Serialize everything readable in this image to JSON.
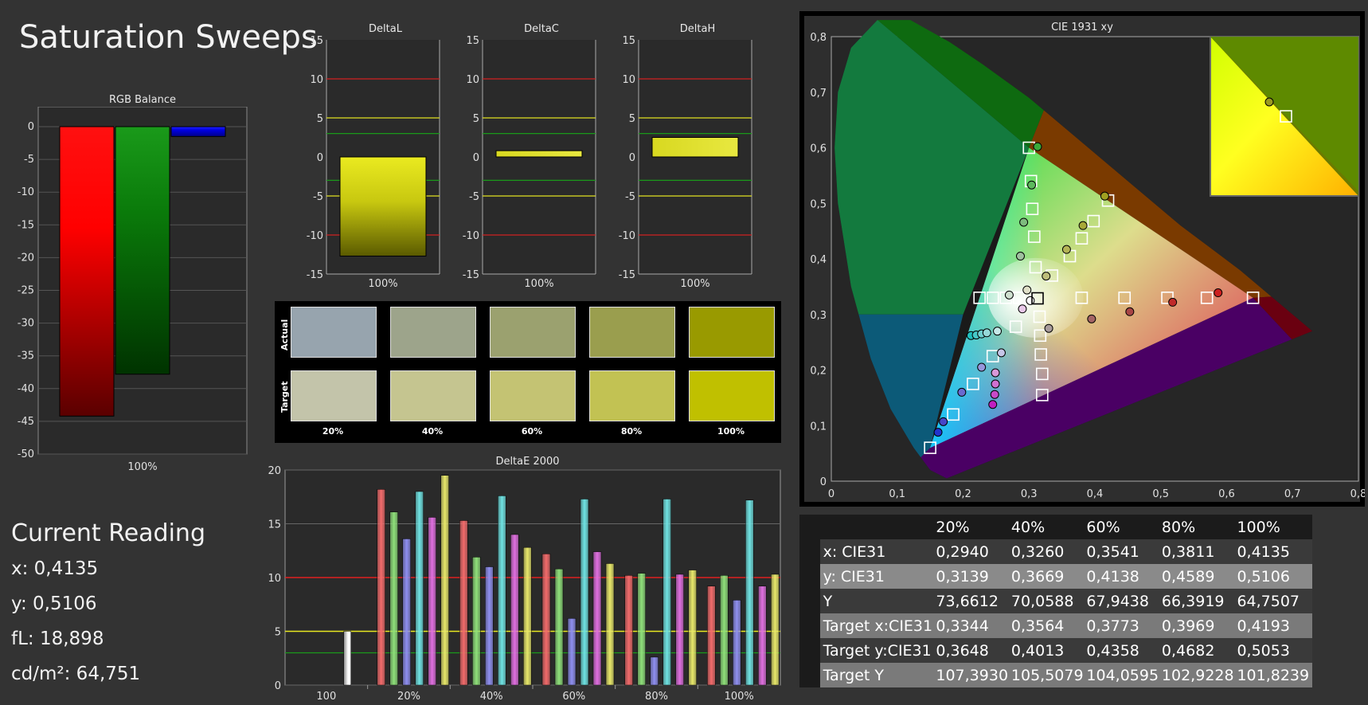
{
  "page_title": "Saturation Sweeps",
  "rgb_balance": {
    "title": "RGB Balance",
    "y_ticks": [
      "0",
      "-5",
      "-10",
      "-15",
      "-20",
      "-25",
      "-30",
      "-35",
      "-40",
      "-45",
      "-50"
    ],
    "x_label": "100%",
    "values": {
      "red": -44.2,
      "green": -37.8,
      "blue": -1.5
    }
  },
  "delta_charts": [
    {
      "title": "DeltaL",
      "value": -12.7,
      "x_label": "100%"
    },
    {
      "title": "DeltaC",
      "value": 0.8,
      "x_label": "100%"
    },
    {
      "title": "DeltaH",
      "value": 2.5,
      "x_label": "100%"
    }
  ],
  "delta_y_ticks": [
    "15",
    "10",
    "5",
    "0",
    "-5",
    "-10",
    "-15"
  ],
  "swatches": {
    "row_actual": "Actual",
    "row_target": "Target",
    "labels": [
      "20%",
      "40%",
      "60%",
      "80%",
      "100%"
    ],
    "actual_colors": [
      "#97a4ae",
      "#9da48b",
      "#9ba16f",
      "#9a9e4e",
      "#999a00"
    ],
    "target_colors": [
      "#c3c4aa",
      "#c5c590",
      "#c4c373",
      "#c2c253",
      "#c0c000"
    ]
  },
  "current_reading": {
    "title": "Current Reading",
    "lines": [
      "x: 0,4135",
      "y: 0,5106",
      "fL: 18,898",
      "cd/m²: 64,751"
    ]
  },
  "delta_e": {
    "title": "DeltaE 2000",
    "y_ticks": [
      "20",
      "15",
      "10",
      "5",
      "0"
    ],
    "categories": [
      "100",
      "20%",
      "40%",
      "60%",
      "80%",
      "100%"
    ],
    "bar_colors": [
      "#f26b6b",
      "#8fe07a",
      "#8f8ff0",
      "#6fe3e3",
      "#e06fe0",
      "#e8e86a"
    ],
    "groups": [
      [
        5.0
      ],
      [
        18.2,
        16.1,
        13.6,
        18.0,
        15.6,
        19.5
      ],
      [
        15.3,
        11.9,
        11.0,
        17.6,
        14.0,
        12.8
      ],
      [
        12.2,
        10.8,
        6.2,
        17.3,
        12.4,
        11.3
      ],
      [
        10.2,
        10.4,
        2.6,
        17.3,
        10.3,
        10.7
      ],
      [
        9.2,
        10.2,
        7.9,
        17.2,
        9.2,
        10.3
      ]
    ]
  },
  "chart_data": [
    {
      "type": "bar",
      "title": "RGB Balance",
      "categories": [
        "100%"
      ],
      "series": [
        {
          "name": "Red",
          "values": [
            -44.2
          ]
        },
        {
          "name": "Green",
          "values": [
            -37.8
          ]
        },
        {
          "name": "Blue",
          "values": [
            -1.5
          ]
        }
      ],
      "ylim": [
        -50,
        0
      ]
    },
    {
      "type": "bar",
      "title": "DeltaL",
      "categories": [
        "100%"
      ],
      "values": [
        -12.7
      ],
      "ylim": [
        -15,
        15
      ]
    },
    {
      "type": "bar",
      "title": "DeltaC",
      "categories": [
        "100%"
      ],
      "values": [
        0.8
      ],
      "ylim": [
        -15,
        15
      ]
    },
    {
      "type": "bar",
      "title": "DeltaH",
      "categories": [
        "100%"
      ],
      "values": [
        2.5
      ],
      "ylim": [
        -15,
        15
      ]
    },
    {
      "type": "bar",
      "title": "DeltaE 2000",
      "categories": [
        "100",
        "20%",
        "40%",
        "60%",
        "80%",
        "100%"
      ],
      "ylim": [
        0,
        20
      ]
    },
    {
      "type": "scatter",
      "title": "CIE 1931 xy",
      "xlim": [
        0,
        0.8
      ],
      "ylim": [
        0,
        0.8
      ],
      "targets": [
        [
          0.64,
          0.33
        ],
        [
          0.57,
          0.33
        ],
        [
          0.51,
          0.33
        ],
        [
          0.445,
          0.33
        ],
        [
          0.38,
          0.33
        ],
        [
          0.3,
          0.6
        ],
        [
          0.303,
          0.54
        ],
        [
          0.305,
          0.49
        ],
        [
          0.308,
          0.44
        ],
        [
          0.31,
          0.385
        ],
        [
          0.15,
          0.06
        ],
        [
          0.185,
          0.12
        ],
        [
          0.215,
          0.175
        ],
        [
          0.245,
          0.225
        ],
        [
          0.28,
          0.278
        ],
        [
          0.42,
          0.505
        ],
        [
          0.398,
          0.468
        ],
        [
          0.38,
          0.437
        ],
        [
          0.362,
          0.405
        ],
        [
          0.335,
          0.37
        ],
        [
          0.32,
          0.155
        ],
        [
          0.32,
          0.193
        ],
        [
          0.318,
          0.228
        ],
        [
          0.317,
          0.262
        ],
        [
          0.316,
          0.296
        ],
        [
          0.225,
          0.33
        ],
        [
          0.245,
          0.33
        ],
        [
          0.265,
          0.33
        ],
        [
          0.285,
          0.33
        ],
        [
          0.313,
          0.329
        ]
      ],
      "measured": [
        {
          "x": 0.587,
          "y": 0.339,
          "c": "#cc2020"
        },
        {
          "x": 0.518,
          "y": 0.322,
          "c": "#c02a2a"
        },
        {
          "x": 0.453,
          "y": 0.305,
          "c": "#a84545"
        },
        {
          "x": 0.395,
          "y": 0.292,
          "c": "#a46464"
        },
        {
          "x": 0.33,
          "y": 0.275,
          "c": "#a99c9c"
        },
        {
          "x": 0.313,
          "y": 0.602,
          "c": "#3aaa3a"
        },
        {
          "x": 0.304,
          "y": 0.533,
          "c": "#5dba5d"
        },
        {
          "x": 0.292,
          "y": 0.466,
          "c": "#7ebb7e"
        },
        {
          "x": 0.287,
          "y": 0.405,
          "c": "#9fc09f"
        },
        {
          "x": 0.27,
          "y": 0.335,
          "c": "#cfe0cf"
        },
        {
          "x": 0.162,
          "y": 0.088,
          "c": "#2233cc"
        },
        {
          "x": 0.17,
          "y": 0.107,
          "c": "#4646c8"
        },
        {
          "x": 0.198,
          "y": 0.16,
          "c": "#6a6ad0"
        },
        {
          "x": 0.228,
          "y": 0.205,
          "c": "#9696dc"
        },
        {
          "x": 0.258,
          "y": 0.231,
          "c": "#c6c6e8"
        },
        {
          "x": 0.415,
          "y": 0.513,
          "c": "#a0a020"
        },
        {
          "x": 0.382,
          "y": 0.46,
          "c": "#a8a838"
        },
        {
          "x": 0.357,
          "y": 0.417,
          "c": "#b4b456"
        },
        {
          "x": 0.326,
          "y": 0.369,
          "c": "#bebe7a"
        },
        {
          "x": 0.297,
          "y": 0.344,
          "c": "#e0e0c8"
        },
        {
          "x": 0.245,
          "y": 0.138,
          "c": "#c020c0"
        },
        {
          "x": 0.248,
          "y": 0.156,
          "c": "#c84ac8"
        },
        {
          "x": 0.249,
          "y": 0.175,
          "c": "#d070d0"
        },
        {
          "x": 0.249,
          "y": 0.195,
          "c": "#d898d8"
        },
        {
          "x": 0.29,
          "y": 0.31,
          "c": "#e8c8e8"
        },
        {
          "x": 0.212,
          "y": 0.262,
          "c": "#20c0c0"
        },
        {
          "x": 0.22,
          "y": 0.263,
          "c": "#46c8c8"
        },
        {
          "x": 0.228,
          "y": 0.265,
          "c": "#6ed0d0"
        },
        {
          "x": 0.236,
          "y": 0.267,
          "c": "#96d8d8"
        },
        {
          "x": 0.252,
          "y": 0.27,
          "c": "#c6e8e8"
        },
        {
          "x": 0.302,
          "y": 0.325,
          "c": "#ffffff"
        }
      ]
    }
  ],
  "cie": {
    "title": "CIE 1931 xy",
    "x_ticks": [
      "0",
      "0,1",
      "0,2",
      "0,3",
      "0,4",
      "0,5",
      "0,6",
      "0,7",
      "0,8"
    ],
    "y_ticks": [
      "0",
      "0,1",
      "0,2",
      "0,3",
      "0,4",
      "0,5",
      "0,6",
      "0,7",
      "0,8"
    ]
  },
  "table": {
    "headers": [
      "",
      "20%",
      "40%",
      "60%",
      "80%",
      "100%"
    ],
    "rows": [
      {
        "label": "x: CIE31",
        "values": [
          "0,2940",
          "0,3260",
          "0,3541",
          "0,3811",
          "0,4135"
        ]
      },
      {
        "label": "y: CIE31",
        "values": [
          "0,3139",
          "0,3669",
          "0,4138",
          "0,4589",
          "0,5106"
        ]
      },
      {
        "label": "Y",
        "values": [
          "73,6612",
          "70,0588",
          "67,9438",
          "66,3919",
          "64,7507"
        ]
      },
      {
        "label": "Target x:CIE31",
        "values": [
          "0,3344",
          "0,3564",
          "0,3773",
          "0,3969",
          "0,4193"
        ]
      },
      {
        "label": "Target y:CIE31",
        "values": [
          "0,3648",
          "0,4013",
          "0,4358",
          "0,4682",
          "0,5053"
        ]
      },
      {
        "label": "Target Y",
        "values": [
          "107,3930",
          "105,5079",
          "104,0595",
          "102,9228",
          "101,8239"
        ]
      }
    ],
    "row_colors": [
      "#3a3a3a",
      "#8a8a8a",
      "#3a3a3a",
      "#7a7a7a",
      "#3a3a3a",
      "#7a7a7a"
    ]
  }
}
